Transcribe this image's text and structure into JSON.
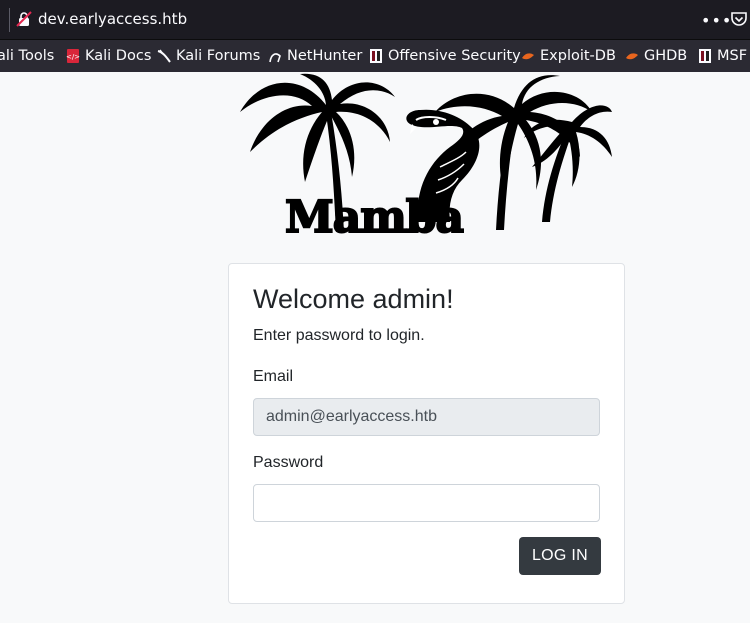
{
  "browser": {
    "url": "dev.earlyaccess.htb",
    "bookmarks": [
      {
        "label": "ali Tools",
        "icon": "kali-tools-icon"
      },
      {
        "label": "Kali Docs",
        "icon": "kali-docs-icon"
      },
      {
        "label": "Kali Forums",
        "icon": "kali-forums-icon"
      },
      {
        "label": "NetHunter",
        "icon": "nethunter-icon"
      },
      {
        "label": "Offensive Security",
        "icon": "offsec-icon"
      },
      {
        "label": "Exploit-DB",
        "icon": "exploit-db-icon"
      },
      {
        "label": "GHDB",
        "icon": "ghdb-icon"
      },
      {
        "label": "MSF",
        "icon": "msf-icon"
      }
    ]
  },
  "logo": {
    "text": "Mamba"
  },
  "login": {
    "title": "Welcome admin!",
    "subtitle": "Enter password to login.",
    "email_label": "Email",
    "email_value": "admin@earlyaccess.htb",
    "password_label": "Password",
    "password_value": "",
    "submit_label": "LOG IN"
  },
  "colors": {
    "chrome_dark": "#1c1b22",
    "bookmarks_bar": "#2b2a33",
    "page_bg": "#f8f9fa",
    "button_bg": "#343a40",
    "readonly_bg": "#e9ecef"
  }
}
